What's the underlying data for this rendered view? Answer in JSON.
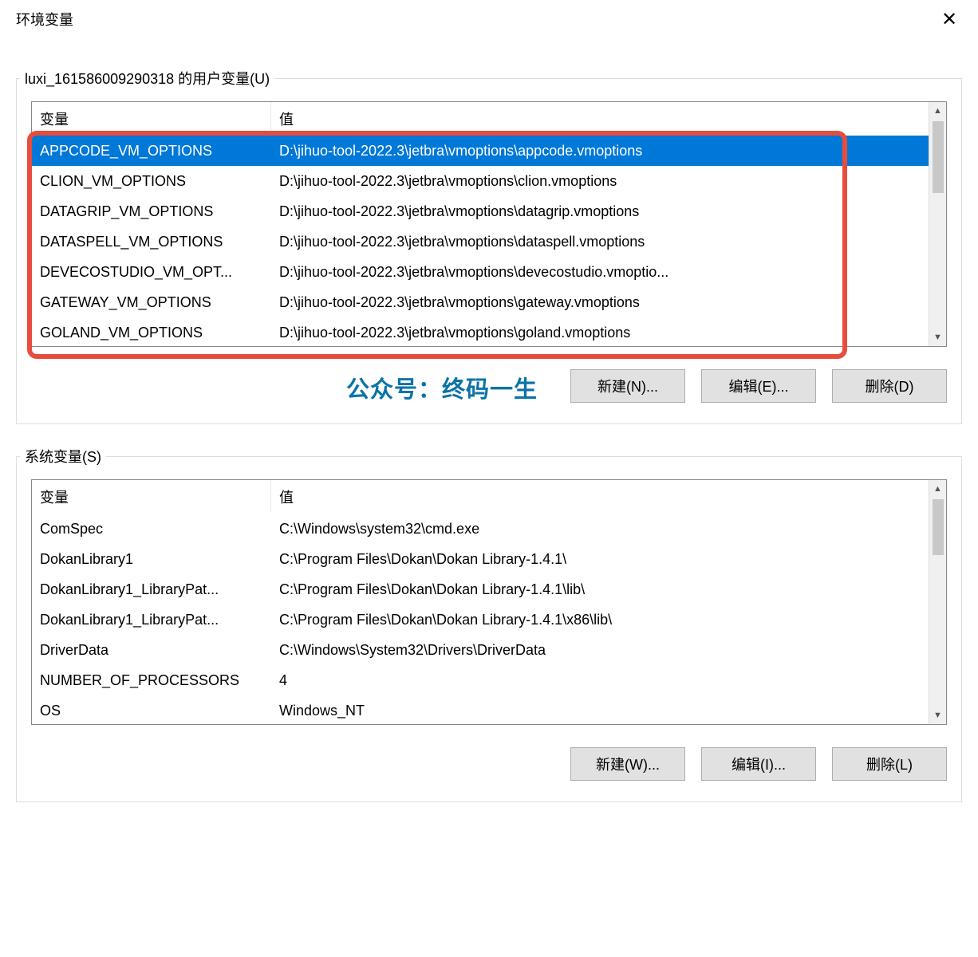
{
  "window_title": "环境变量",
  "user_group_label": "luxi_161586009290318 的用户变量(U)",
  "sys_group_label": "系统变量(S)",
  "columns": {
    "name": "变量",
    "value": "值"
  },
  "user_vars": [
    {
      "name": "APPCODE_VM_OPTIONS",
      "value": "D:\\jihuo-tool-2022.3\\jetbra\\vmoptions\\appcode.vmoptions",
      "selected": true
    },
    {
      "name": "CLION_VM_OPTIONS",
      "value": "D:\\jihuo-tool-2022.3\\jetbra\\vmoptions\\clion.vmoptions"
    },
    {
      "name": "DATAGRIP_VM_OPTIONS",
      "value": "D:\\jihuo-tool-2022.3\\jetbra\\vmoptions\\datagrip.vmoptions"
    },
    {
      "name": "DATASPELL_VM_OPTIONS",
      "value": "D:\\jihuo-tool-2022.3\\jetbra\\vmoptions\\dataspell.vmoptions"
    },
    {
      "name": "DEVECOSTUDIO_VM_OPT...",
      "value": "D:\\jihuo-tool-2022.3\\jetbra\\vmoptions\\devecostudio.vmoptio..."
    },
    {
      "name": "GATEWAY_VM_OPTIONS",
      "value": "D:\\jihuo-tool-2022.3\\jetbra\\vmoptions\\gateway.vmoptions"
    },
    {
      "name": "GOLAND_VM_OPTIONS",
      "value": "D:\\jihuo-tool-2022.3\\jetbra\\vmoptions\\goland.vmoptions"
    }
  ],
  "sys_vars": [
    {
      "name": "ComSpec",
      "value": "C:\\Windows\\system32\\cmd.exe"
    },
    {
      "name": "DokanLibrary1",
      "value": "C:\\Program Files\\Dokan\\Dokan Library-1.4.1\\"
    },
    {
      "name": "DokanLibrary1_LibraryPat...",
      "value": "C:\\Program Files\\Dokan\\Dokan Library-1.4.1\\lib\\"
    },
    {
      "name": "DokanLibrary1_LibraryPat...",
      "value": "C:\\Program Files\\Dokan\\Dokan Library-1.4.1\\x86\\lib\\"
    },
    {
      "name": "DriverData",
      "value": "C:\\Windows\\System32\\Drivers\\DriverData"
    },
    {
      "name": "NUMBER_OF_PROCESSORS",
      "value": "4"
    },
    {
      "name": "OS",
      "value": "Windows_NT"
    }
  ],
  "buttons": {
    "user_new": "新建(N)...",
    "user_edit": "编辑(E)...",
    "user_delete": "删除(D)",
    "sys_new": "新建(W)...",
    "sys_edit": "编辑(I)...",
    "sys_delete": "删除(L)"
  },
  "watermark": "公众号：终码一生"
}
